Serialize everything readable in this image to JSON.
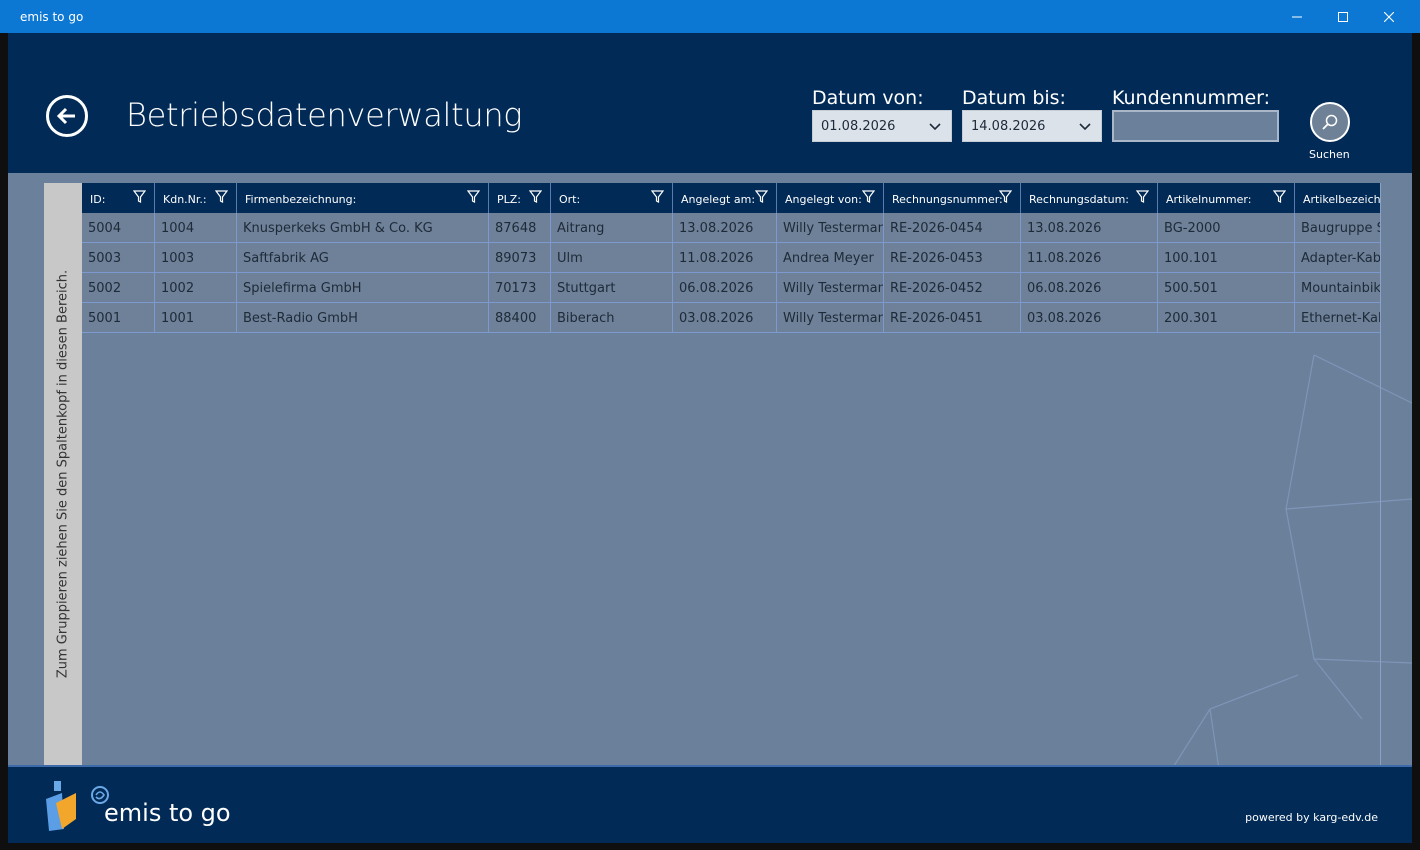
{
  "window": {
    "title": "emis to go"
  },
  "header": {
    "title": "Betriebsdatenverwaltung",
    "date_from_label": "Datum von:",
    "date_from_value": "01.08.2026",
    "date_to_label": "Datum bis:",
    "date_to_value": "14.08.2026",
    "customer_label": "Kundennummer:",
    "customer_value": "",
    "search_label": "Suchen"
  },
  "group_panel": {
    "text": "Zum Gruppieren ziehen Sie den Spaltenkopf in diesen Bereich."
  },
  "table": {
    "columns": [
      "ID:",
      "Kdn.Nr.:",
      "Firmenbezeichnung:",
      "PLZ:",
      "Ort:",
      "Angelegt am:",
      "Angelegt von:",
      "Rechnungsnummer:",
      "Rechnungsdatum:",
      "Artikelnummer:",
      "Artikelbezeichnung:"
    ],
    "rows": [
      [
        "5004",
        "1004",
        "Knusperkeks GmbH & Co. KG",
        "87648",
        "Aitrang",
        "13.08.2026",
        "Willy Testermann",
        "RE-2026-0454",
        "13.08.2026",
        "BG-2000",
        "Baugruppe S"
      ],
      [
        "5003",
        "1003",
        "Saftfabrik AG",
        "89073",
        "Ulm",
        "11.08.2026",
        "Andrea Meyer",
        "RE-2026-0453",
        "11.08.2026",
        "100.101",
        "Adapter-Kab"
      ],
      [
        "5002",
        "1002",
        "Spielefirma GmbH",
        "70173",
        "Stuttgart",
        "06.08.2026",
        "Willy Testermann",
        "RE-2026-0452",
        "06.08.2026",
        "500.501",
        "Mountainbik"
      ],
      [
        "5001",
        "1001",
        "Best-Radio GmbH",
        "88400",
        "Biberach",
        "03.08.2026",
        "Willy Testermann",
        "RE-2026-0451",
        "03.08.2026",
        "200.301",
        "Ethernet-Kab"
      ]
    ]
  },
  "footer": {
    "brand": "emis to go",
    "powered": "powered by karg-edv.de"
  },
  "icons": {
    "back": "back-arrow-icon",
    "search": "magnifier-icon",
    "filter": "funnel-icon",
    "dropdown": "chevron-down-icon",
    "minimize": "minimize-icon",
    "maximize": "maximize-icon",
    "close": "close-icon"
  },
  "colors": {
    "titlebar": "#0c78d4",
    "header": "#012a56",
    "body": "#6b809a",
    "grid_line": "#7d9ad0"
  }
}
